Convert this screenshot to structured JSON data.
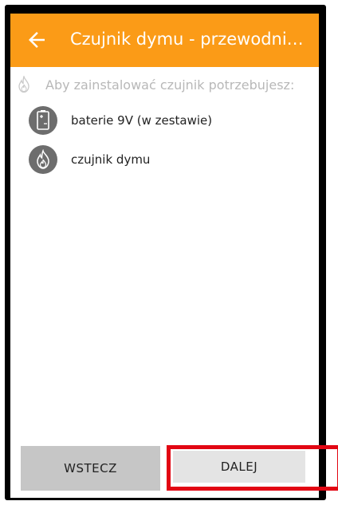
{
  "header": {
    "title": "Czujnik dymu - przewodni…",
    "background": "#fb9b17",
    "back_icon": "arrow-left-icon"
  },
  "content": {
    "intro": "Aby zainstalować czujnik potrzebujesz:",
    "intro_icon": "flame-outline-icon",
    "items": [
      {
        "label": "baterie 9V (w zestawie)",
        "icon": "battery-icon"
      },
      {
        "label": "czujnik dymu",
        "icon": "flame-icon"
      }
    ]
  },
  "footer": {
    "back_label": "WSTECZ",
    "next_label": "DALEJ",
    "highlight_color": "#e20613"
  }
}
